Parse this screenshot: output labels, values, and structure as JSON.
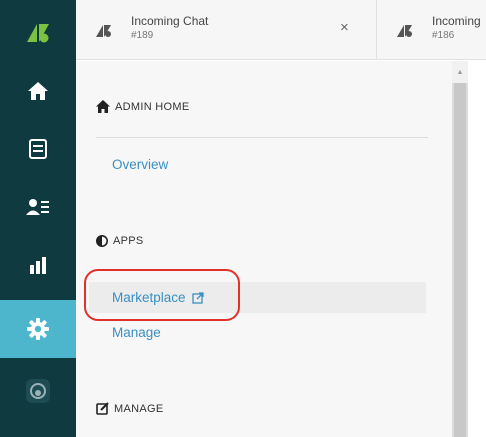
{
  "tabs": [
    {
      "title": "Incoming Chat",
      "subtitle": "#189",
      "close_label": "×"
    },
    {
      "title": "Incoming",
      "subtitle": "#186"
    }
  ],
  "admin": {
    "sections": [
      {
        "title": "ADMIN HOME",
        "icon": "home-icon",
        "links": [
          "Overview"
        ]
      },
      {
        "title": "APPS",
        "icon": "apps-icon",
        "links": [
          "Marketplace",
          "Manage"
        ]
      },
      {
        "title": "MANAGE",
        "icon": "edit-icon",
        "links": []
      }
    ]
  },
  "colors": {
    "rail": "#0f3a3f",
    "rail_active": "#4db6cc",
    "link": "#3a8fc2",
    "highlight": "#e0322b"
  },
  "rail_icons": [
    "zendesk-logo",
    "home-icon",
    "inbox-icon",
    "contacts-icon",
    "reports-icon",
    "settings-icon",
    "status-icon"
  ]
}
